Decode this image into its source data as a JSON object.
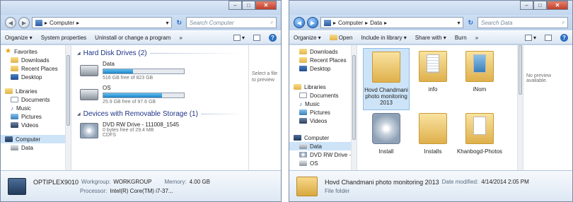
{
  "w1": {
    "address": [
      "Computer"
    ],
    "search_placeholder": "Search Computer",
    "toolbar": [
      "Organize ▾",
      "System properties",
      "Uninstall or change a program",
      "»"
    ],
    "nav": {
      "favorites": "Favorites",
      "downloads": "Downloads",
      "recent": "Recent Places",
      "desktop": "Desktop",
      "libraries": "Libraries",
      "documents": "Documents",
      "music": "Music",
      "pictures": "Pictures",
      "videos": "Videos",
      "computer": "Computer",
      "data": "Data"
    },
    "hdd_header": "Hard Disk Drives (2)",
    "drives": [
      {
        "name": "Data",
        "free": "516 GB free of 823 GB",
        "used_fraction": 0.37
      },
      {
        "name": "OS",
        "free": "25.9 GB free of 97.6 GB",
        "used_fraction": 0.73
      }
    ],
    "removable_header": "Devices with Removable Storage (1)",
    "dvd": {
      "name": "DVD RW Drive - 111008_1545",
      "free": "0 bytes free of 29.4 MB",
      "fs": "CDFS"
    },
    "preview": [
      "Select a file",
      "to preview"
    ],
    "details": {
      "name": "OPTIPLEX9010",
      "workgroup_label": "Workgroup:",
      "workgroup": "WORKGROUP",
      "memory_label": "Memory:",
      "memory": "4.00 GB",
      "processor_label": "Processor:",
      "processor": "Intel(R) Core(TM) i7-37..."
    }
  },
  "w2": {
    "address": [
      "Computer",
      "Data"
    ],
    "search_placeholder": "Search Data",
    "toolbar": [
      "Organize ▾",
      "Open",
      "Include in library ▾",
      "Share with ▾",
      "Burn",
      "»"
    ],
    "nav": {
      "downloads": "Downloads",
      "recent": "Recent Places",
      "desktop": "Desktop",
      "libraries": "Libraries",
      "documents": "Documents",
      "music": "Music",
      "pictures": "Pictures",
      "videos": "Videos",
      "computer": "Computer",
      "data": "Data",
      "dvd": "DVD RW Drive -",
      "os": "OS"
    },
    "files": [
      {
        "name": "Hovd Chandmani photo monitoring 2013"
      },
      {
        "name": "info"
      },
      {
        "name": "iNom"
      },
      {
        "name": "Install"
      },
      {
        "name": "Installs"
      },
      {
        "name": "Khanbogd-Photos"
      }
    ],
    "preview": "No preview available.",
    "details": {
      "name": "Hovd Chandmani photo monitoring 2013",
      "modified_label": "Date modified:",
      "modified": "4/14/2014 2:05 PM",
      "type": "File folder"
    }
  }
}
